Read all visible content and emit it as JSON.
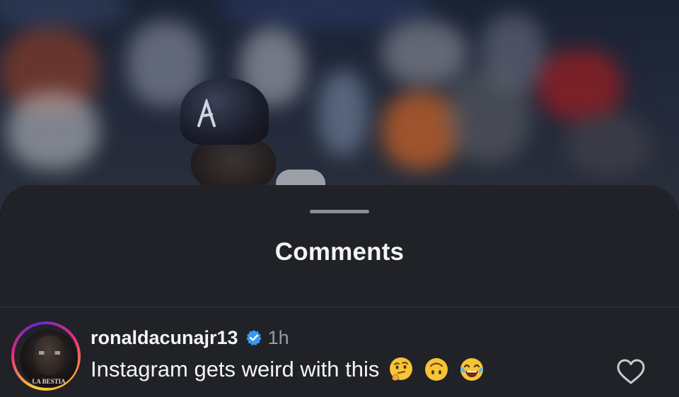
{
  "video": {
    "helmet_logo": "A"
  },
  "sheet": {
    "title": "Comments"
  },
  "comment": {
    "username": "ronaldacunajr13",
    "verified": true,
    "time": "1h",
    "text": "Instagram gets weird with this",
    "emojis": [
      "thinking-face",
      "upside-down-face",
      "tears-of-joy-face"
    ],
    "avatar_caption": "LA BESTIA"
  },
  "colors": {
    "sheet_bg": "#202227",
    "verified_badge": "#3897f0",
    "text_primary": "#f3f4f6",
    "text_secondary": "#9a9ca3"
  }
}
